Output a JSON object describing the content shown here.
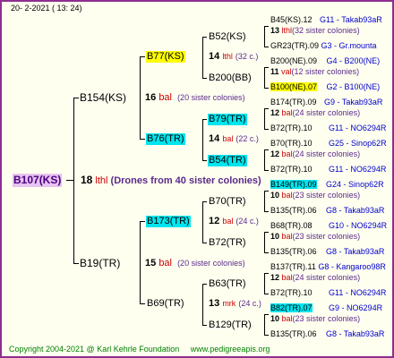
{
  "header": {
    "date": "20-  2-2021 ( 13:  24)"
  },
  "root": {
    "label": "B107(KS)",
    "count": "18",
    "type": "lthl",
    "note": "(Drones from 40 sister colonies)"
  },
  "gen2": [
    {
      "label": "B154(KS)",
      "count": "16",
      "type": "bal",
      "note": "(20 sister colonies)"
    },
    {
      "label": "B19(TR)",
      "count": "15",
      "type": "bal",
      "note": "(20 sister colonies)"
    }
  ],
  "gen3": [
    {
      "label": "B77(KS)",
      "count": "14",
      "type": "lthl",
      "note": "(32 c.)"
    },
    {
      "label": "B76(TR)",
      "count": "14",
      "type": "bal",
      "note": "(22 c.)"
    },
    {
      "label": "B173(TR)",
      "count": "12",
      "type": "bal",
      "note": "(24 c.)"
    },
    {
      "label": "B69(TR)",
      "count": "13",
      "type": "mrk",
      "note": "(24 c.)"
    }
  ],
  "gen4": [
    {
      "label": "B52(KS)"
    },
    {
      "label": "B200(BB)"
    },
    {
      "label": "B79(TR)"
    },
    {
      "label": "B54(TR)"
    },
    {
      "label": "B70(TR)"
    },
    {
      "label": "B72(TR)"
    },
    {
      "label": "B63(TR)"
    },
    {
      "label": "B129(TR)"
    }
  ],
  "gen5": [
    {
      "label": "B45(KS).12",
      "info": "G11 - Takab93aR"
    },
    {
      "label": "GR23(TR).09",
      "info": "G3 - Gr.mounta"
    },
    {
      "label": "B200(NE).09",
      "info": "G4 - B200(NE)"
    },
    {
      "label": "B100(NE).07",
      "info": "G2 - B100(NE)"
    },
    {
      "label": "B174(TR).09",
      "info": "G9 - Takab93aR"
    },
    {
      "label": "B72(TR).10",
      "info": "G11 - NO6294R"
    },
    {
      "label": "B70(TR).10",
      "info": "G25 - Sinop62R"
    },
    {
      "label": "B72(TR).10",
      "info": "G11 - NO6294R"
    },
    {
      "label": "B149(TR).09",
      "info": "G24 - Sinop62R"
    },
    {
      "label": "B135(TR).06",
      "info": "G8 - Takab93aR"
    },
    {
      "label": "B68(TR).08",
      "info": "G10 - NO6294R"
    },
    {
      "label": "B135(TR).06",
      "info": "G8 - Takab93aR"
    },
    {
      "label": "B137(TR).11",
      "info": "G8 - Kangaroo98R"
    },
    {
      "label": "B72(TR).10",
      "info": "G11 - NO6294R"
    },
    {
      "label": "B82(TR).07",
      "info": "G9 - NO6294R"
    },
    {
      "label": "B135(TR).06",
      "info": "G8 - Takab93aR"
    }
  ],
  "gen4_drones": [
    {
      "count": "13",
      "type": "lthl",
      "note": "(32 sister colonies)"
    },
    {
      "count": "11",
      "type": "val",
      "note": "(12 sister colonies)"
    },
    {
      "count": "12",
      "type": "bal",
      "note": "(24 sister colonies)"
    },
    {
      "count": "12",
      "type": "bal",
      "note": "(24 sister colonies)"
    },
    {
      "count": "10",
      "type": "bal",
      "note": "(23 sister colonies)"
    },
    {
      "count": "10",
      "type": "bal",
      "note": "(23 sister colonies)"
    },
    {
      "count": "12",
      "type": "bal",
      "note": "(24 sister colonies)"
    },
    {
      "count": "10",
      "type": "bal",
      "note": "(23 sister colonies)"
    }
  ],
  "footer": {
    "copyright": "Copyright 2004-2021 @ Karl Kehrle Foundation",
    "url": "www.pedigreeapis.org"
  },
  "colors": {
    "frame": "#8e2f8e",
    "yellow": "#ffff00",
    "cyan": "#00e5ee",
    "root": "#e7c3ef",
    "drone_red": "#cc0000",
    "info_blue": "#0000cc",
    "footer_green": "#008000"
  }
}
